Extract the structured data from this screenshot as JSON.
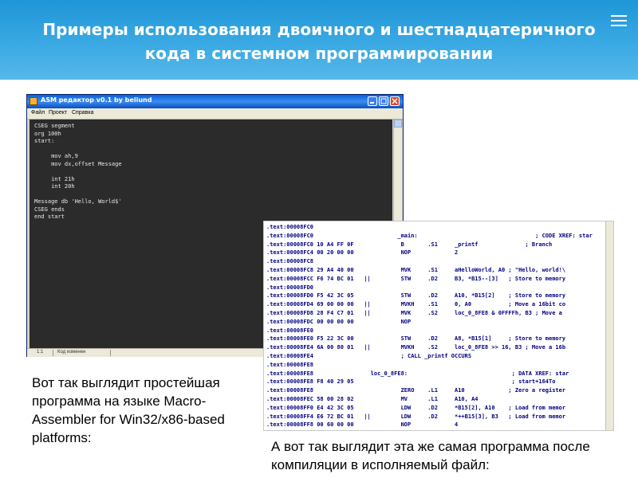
{
  "slide": {
    "title": "Примеры использования двоичного и шестнадцатеричного кода в системном программировании",
    "caption_left": "Вот так выглядит простейшая программа на языке Macro-Assembler for Win32/x86-based platforms:",
    "caption_right": "А вот так выглядит эта же самая программа после компиляции в исполняемый файл:",
    "header_color": "#2ea3e0"
  },
  "editor": {
    "title": "ASM редактор v0.1 by beliund",
    "menu": [
      "Файл",
      "Проект",
      "Справка"
    ],
    "code_lines": [
      "CSEG segment",
      "org 100h",
      "start:",
      "",
      "     mov ah,9",
      "     mov dx,offset Message",
      "",
      "     int 21h",
      "     int 20h",
      "",
      "Message db 'Hello, World$'",
      "CSEG ends",
      "end start"
    ],
    "status_position": "1:1",
    "status_text": "Код изменен",
    "code_bg": "#2b2b2b"
  },
  "listing": {
    "lines": [
      ".text:00008FC0",
      ".text:00008FC0                         _main:                                   ; CODE XREF: star",
      ".text:00008FC0 10 A4 FF 0F              B       .S1     _printf              ; Branch",
      ".text:00008FC4 00 20 00 00              NOP             2",
      ".text:00008FC8",
      ".text:00008FC8 29 A4 40 00              MVK     .S1     aHelloWorld, A0 ; \"Hello, world!\\",
      ".text:00008FCC F6 74 BC 01   ||         STW     .D2     B3, *B15--[3]   ; Store to memory",
      ".text:00008FD0",
      ".text:00008FD0 F5 42 3C 05              STW     .D2     A10, *B15[2]    ; Store to memory",
      ".text:00008FD4 69 00 00 00   ||         MVKH    .S1     0, A0           ; Move a 16bit co",
      ".text:00008FD8 28 F4 C7 01   ||         MVK     .S2     loc_0_8FE8 & 0FFFFh, B3 ; Move a",
      ".text:00008FDC 00 00 00 00              NOP",
      ".text:00008FE0",
      ".text:00008FE0 F5 22 3C 00              STW     .D2     A8, *B15[1]     ; Store to memory",
      ".text:00008FE4 6A 00 80 01   ||         MVKH    .S2     loc_0_8FE8 >> 16, B3 ; Move a 16b",
      ".text:00008FE4                          ; CALL _printf OCCURS",
      ".text:00008FE8",
      ".text:00008FE8                 loc_0_8FE8:                               ; DATA XREF: star",
      ".text:00008FE8 F8 40 29 05                                               ; start+164To",
      ".text:00008FE8                          ZERO    .L1     A10             ; Zero a register",
      ".text:00008FEC 58 00 28 02              MV      .L1     A10, A4",
      ".text:00008FF0 E4 42 3C 05              LDW     .D2     *B15[2], A10    ; Load from memor",
      ".text:00008FF4 E6 72 BC 01   ||         LDW     .D2     *++B15[3], B3   ; Load from memor",
      ".text:00008FF8 00 60 00 00              NOP             4"
    ],
    "text_color": "#000080"
  }
}
